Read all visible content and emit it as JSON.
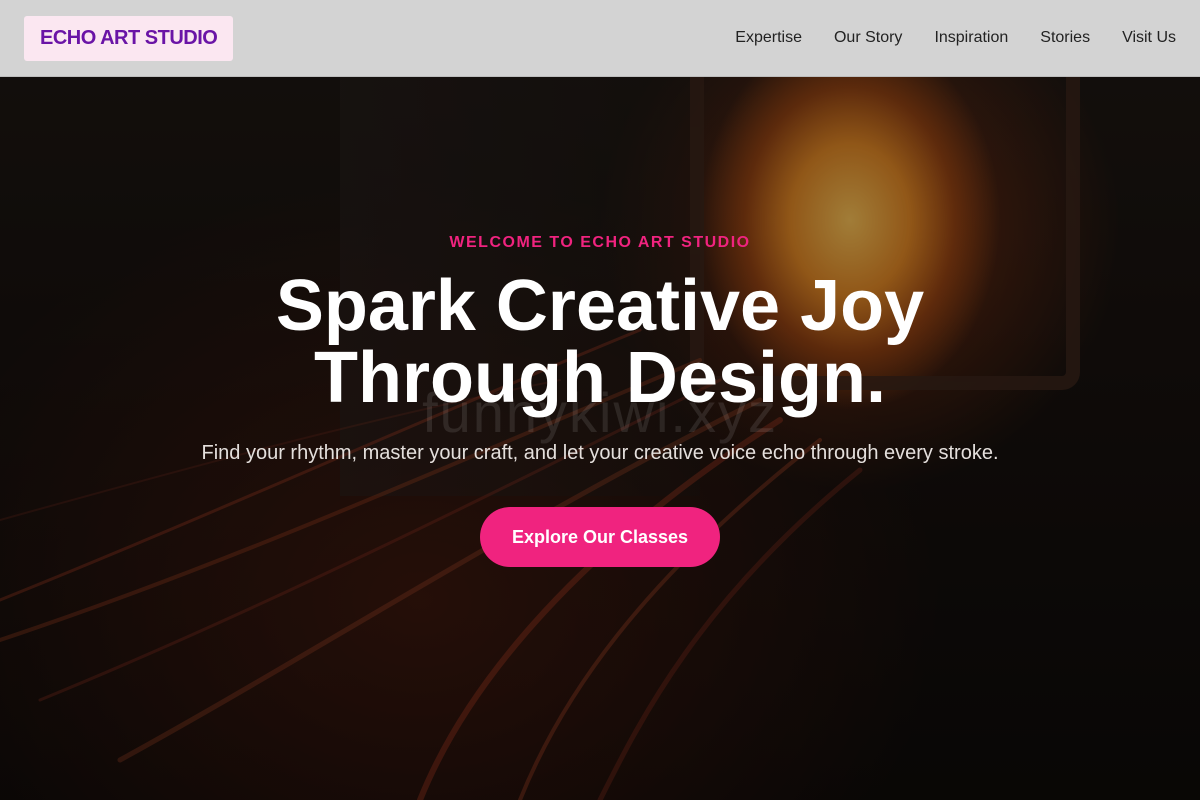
{
  "header": {
    "logo": "ECHO ART STUDIO",
    "nav": [
      "Expertise",
      "Our Story",
      "Inspiration",
      "Stories",
      "Visit Us"
    ]
  },
  "hero": {
    "eyebrow": "WELCOME TO ECHO ART STUDIO",
    "headline_line1": "Spark Creative Joy",
    "headline_line2": "Through Design.",
    "subtitle": "Find your rhythm, master your craft, and let your creative voice echo through every stroke.",
    "cta_label": "Explore Our Classes",
    "watermark": "funnykiwi.xyz"
  },
  "colors": {
    "accent": "#f0237f",
    "logo_text": "#6a14a6",
    "logo_bg": "#fbe7f1",
    "header_bg": "#d3d3d3"
  }
}
